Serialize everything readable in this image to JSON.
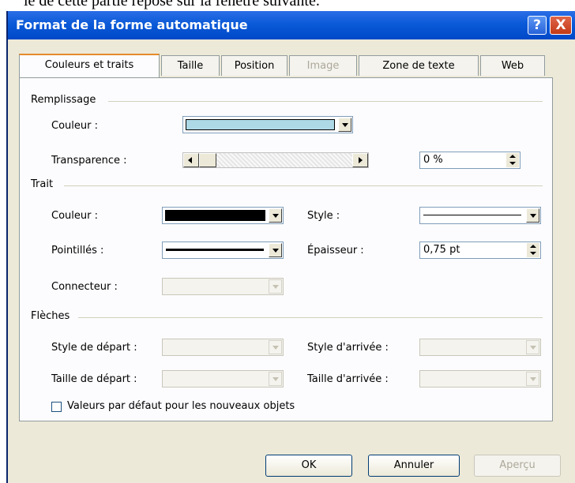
{
  "caption": "le de cette partie repose sur la fenêtre suivante.",
  "window": {
    "title": "Format de la forme automatique",
    "help_icon": "?",
    "close_icon": "X"
  },
  "tabs": [
    {
      "label": "Couleurs et traits",
      "active": true,
      "disabled": false
    },
    {
      "label": "Taille",
      "active": false,
      "disabled": false
    },
    {
      "label": "Position",
      "active": false,
      "disabled": false
    },
    {
      "label": "Image",
      "active": false,
      "disabled": true
    },
    {
      "label": "Zone de texte",
      "active": false,
      "disabled": false
    },
    {
      "label": "Web",
      "active": false,
      "disabled": false
    }
  ],
  "remplissage": {
    "heading": "Remplissage",
    "couleur_label": "Couleur :",
    "couleur_value_color": "#add8e6",
    "transparence_label": "Transparence :",
    "transparence_value": "0 %",
    "transparence_level": 0
  },
  "trait": {
    "heading": "Trait",
    "couleur_label": "Couleur :",
    "couleur_value_color": "#000000",
    "style_label": "Style :",
    "pointilles_label": "Pointillés :",
    "epaisseur_label": "Épaisseur :",
    "epaisseur_value": "0,75 pt",
    "connecteur_label": "Connecteur :"
  },
  "fleches": {
    "heading": "Flèches",
    "style_depart_label": "Style de départ :",
    "style_arrivee_label": "Style d'arrivée :",
    "taille_depart_label": "Taille de départ :",
    "taille_arrivee_label": "Taille d'arrivée :"
  },
  "defaults_checkbox": {
    "label": "Valeurs par défaut pour les nouveaux objets",
    "checked": false
  },
  "buttons": {
    "ok": "OK",
    "cancel": "Annuler",
    "preview": "Aperçu"
  }
}
